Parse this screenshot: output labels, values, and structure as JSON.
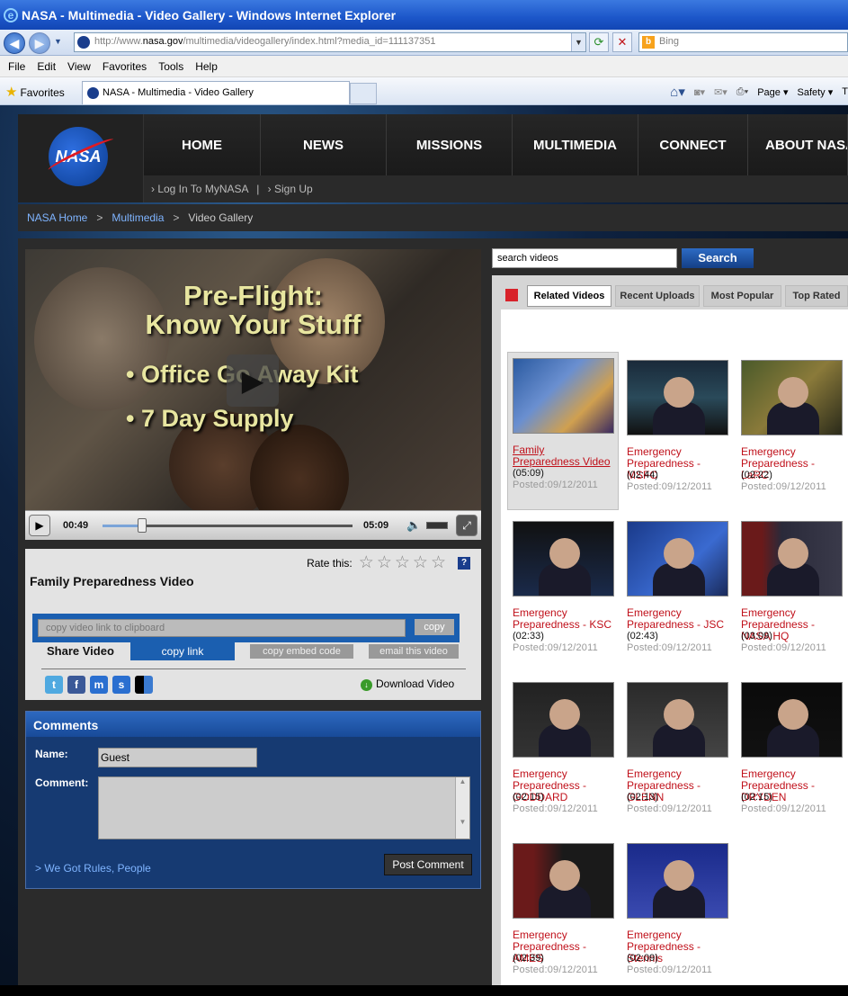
{
  "browser": {
    "title": "NASA - Multimedia - Video Gallery - Windows Internet Explorer",
    "url_prefix": "http://www.",
    "url_domain": "nasa.gov",
    "url_suffix": "/multimedia/videogallery/index.html?media_id=111137351",
    "search_placeholder": "Bing",
    "menu": [
      "File",
      "Edit",
      "View",
      "Favorites",
      "Tools",
      "Help"
    ],
    "favorites_label": "Favorites",
    "tab_title": "NASA - Multimedia - Video Gallery",
    "commands": {
      "page": "Page",
      "safety": "Safety",
      "tools_t": "T"
    }
  },
  "site": {
    "logo_text": "NASA",
    "nav": [
      "HOME",
      "NEWS",
      "MISSIONS",
      "MULTIMEDIA",
      "CONNECT",
      "ABOUT NASA"
    ],
    "login_link": "› Log In To MyNASA",
    "separator": "|",
    "signup_link": "› Sign Up",
    "breadcrumb": {
      "home": "NASA Home",
      "sep": ">",
      "multimedia": "Multimedia",
      "current": "Video Gallery"
    }
  },
  "player": {
    "overlay_title_1": "Pre-Flight:",
    "overlay_title_2": "Know Your Stuff",
    "bullet_1": "• Office Go Away Kit",
    "bullet_2": "• 7 Day Supply",
    "current_time": "00:49",
    "total_time": "05:09",
    "progress": 0.158
  },
  "info": {
    "rate_label": "Rate this:",
    "rating_stars_total": 5,
    "help": "?",
    "video_title": "Family Preparedness Video",
    "link_placeholder": "copy video link to clipboard",
    "copy_btn": "copy",
    "share_label": "Share Video",
    "tabs": [
      "copy link",
      "copy embed code",
      "email this video"
    ],
    "download": "Download Video"
  },
  "comments": {
    "header": "Comments",
    "name_label": "Name:",
    "name_value": "Guest",
    "comment_label": "Comment:",
    "rules_link": "> We Got Rules, People",
    "post_btn": "Post Comment"
  },
  "sidebar": {
    "search_value": "search videos",
    "search_btn": "Search",
    "tabs": [
      "Related Videos",
      "Recent Uploads",
      "Most Popular",
      "Top Rated"
    ],
    "videos": [
      {
        "title": "Family Preparedness Video",
        "duration": "(05:09)",
        "posted": "Posted:09/12/2011"
      },
      {
        "title": "Emergency Preparedness - MSFC",
        "duration": "(02:44)",
        "posted": "Posted:09/12/2011"
      },
      {
        "title": "Emergency Preparedness - LaRC",
        "duration": "(02:22)",
        "posted": "Posted:09/12/2011"
      },
      {
        "title": "Emergency Preparedness - KSC",
        "duration": "(02:33)",
        "posted": "Posted:09/12/2011"
      },
      {
        "title": "Emergency Preparedness - JSC",
        "duration": "(02:43)",
        "posted": "Posted:09/12/2011"
      },
      {
        "title": "Emergency Preparedness - NASA HQ",
        "duration": "(03:09)",
        "posted": "Posted:09/12/2011"
      },
      {
        "title": "Emergency Preparedness - GODDARD",
        "duration": "(02:15)",
        "posted": "Posted:09/12/2011"
      },
      {
        "title": "Emergency Preparedness - GLENN",
        "duration": "(02:13)",
        "posted": "Posted:09/12/2011"
      },
      {
        "title": "Emergency Preparedness - DRYDEN",
        "duration": "(02:15)",
        "posted": "Posted:09/12/2011"
      },
      {
        "title": "Emergency Preparedness - AMES",
        "duration": "(02:39)",
        "posted": "Posted:09/12/2011"
      },
      {
        "title": "Emergency Preparedness - Stennis",
        "duration": "(02:09)",
        "posted": "Posted:09/12/2011"
      }
    ]
  }
}
